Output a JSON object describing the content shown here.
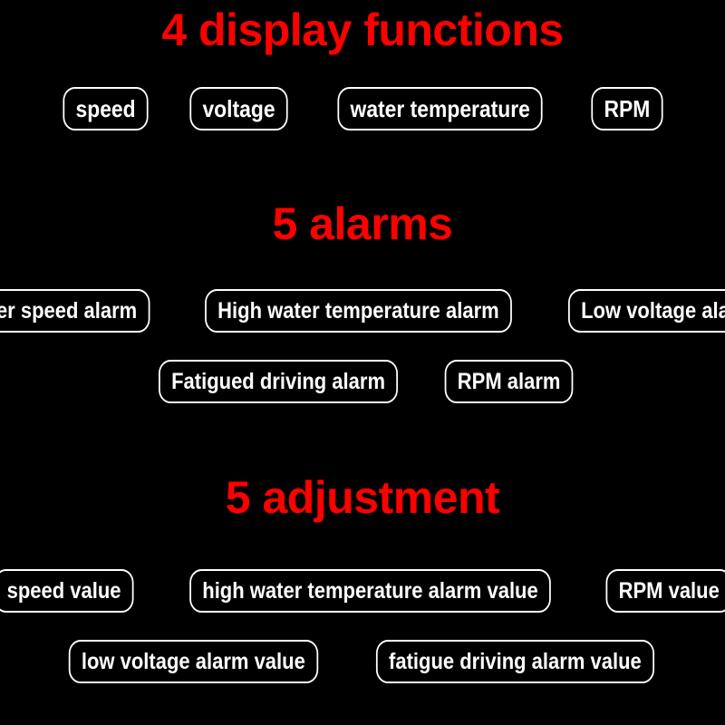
{
  "background_color": "#000000",
  "title_color": "#ff0000",
  "pill_border_color": "#ffffff",
  "pill_text_color": "#ffffff",
  "sections": [
    {
      "id": "display",
      "title": "4 display functions",
      "rows": [
        {
          "items": [
            {
              "label": "speed"
            },
            {
              "label": "voltage"
            },
            {
              "label": "water temperature"
            },
            {
              "label": "RPM"
            }
          ]
        }
      ]
    },
    {
      "id": "alarms",
      "title": "5 alarms",
      "rows": [
        {
          "items": [
            {
              "label": "Over speed alarm"
            },
            {
              "label": "High water temperature alarm"
            },
            {
              "label": "Low voltage alarm"
            }
          ]
        },
        {
          "items": [
            {
              "label": "Fatigued driving alarm"
            },
            {
              "label": "RPM alarm"
            }
          ]
        }
      ]
    },
    {
      "id": "adjust",
      "title": "5 adjustment",
      "rows": [
        {
          "items": [
            {
              "label": "speed value"
            },
            {
              "label": "high water temperature alarm value"
            },
            {
              "label": "RPM value"
            }
          ]
        },
        {
          "items": [
            {
              "label": "low voltage alarm value"
            },
            {
              "label": "fatigue driving alarm value"
            }
          ]
        }
      ]
    }
  ]
}
